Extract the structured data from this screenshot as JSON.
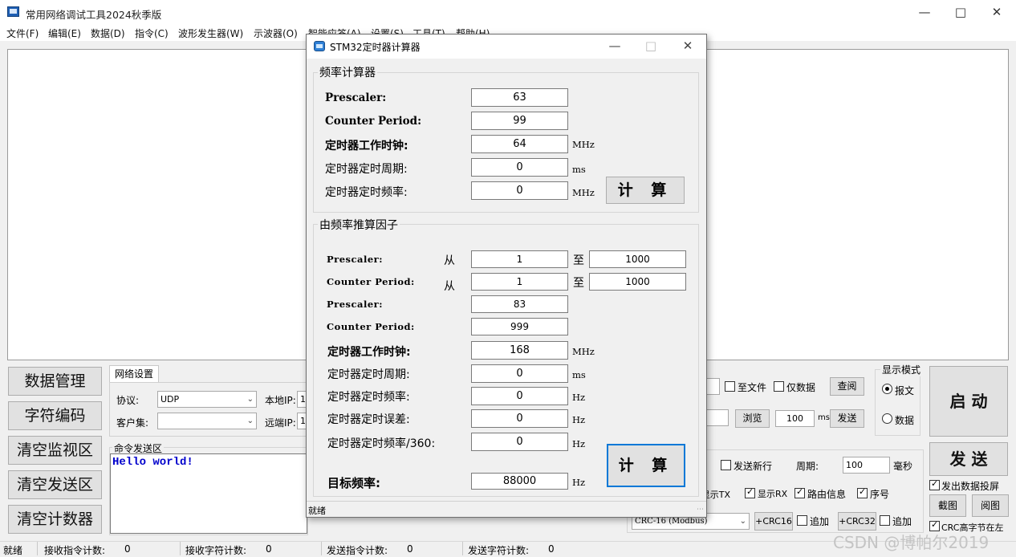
{
  "window": {
    "title": "常用网络调试工具2024秋季版"
  },
  "menu": [
    "文件(F)",
    "编辑(E)",
    "数据(D)",
    "指令(C)",
    "波形发生器(W)",
    "示波器(O)",
    "智能应答(A)",
    "设置(S)",
    "工具(T)",
    "帮助(H)"
  ],
  "left_buttons": [
    "数据管理",
    "字符编码",
    "清空监视区",
    "清空发送区",
    "清空计数器"
  ],
  "net": {
    "tab": "网络设置",
    "protocol_label": "协议:",
    "protocol_value": "UDP",
    "local_ip_label": "本地IP:",
    "local_ip_value": "1",
    "client_label": "客户集:",
    "client_value": "",
    "remote_ip_label": "远端IP:",
    "remote_ip_value": "1"
  },
  "command": {
    "title": "命令发送区",
    "text": "Hello world!"
  },
  "receive_opts": {
    "to_file": "至文件",
    "data_only": "仅数据",
    "view": "查阅",
    "browse": "浏览",
    "interval": "100",
    "ms": "ms",
    "send": "发送"
  },
  "send_opts": {
    "newline": "发送新行",
    "period_label": "周期:",
    "period_value": "100",
    "period_unit": "毫秒",
    "show_tx": "显示TX",
    "show_rx": "显示RX",
    "route_info": "路由信息",
    "seq": "序号",
    "crc_select": "CRC-16 (Modbus)",
    "crc16": "+CRC16",
    "append1": "追加",
    "crc32": "+CRC32",
    "append2": "追加"
  },
  "display_mode": {
    "title": "显示模式",
    "option1": "报文",
    "option2": "数据"
  },
  "right": {
    "start": "启 动",
    "send": "发 送",
    "sendout_screen": "发出数据投屏",
    "screenshot": "截图",
    "view_image": "阅图",
    "crc_high": "CRC高字节在左"
  },
  "status": {
    "ready": "就绪",
    "rx_cmd_label": "接收指令计数:",
    "rx_cmd": "0",
    "rx_char_label": "接收字符计数:",
    "rx_char": "0",
    "tx_cmd_label": "发送指令计数:",
    "tx_cmd": "0",
    "tx_char_label": "发送字符计数:",
    "tx_char": "0"
  },
  "watermark": "CSDN @博帕尔2019",
  "dialog": {
    "title": "STM32定时器计算器",
    "freq_calc": {
      "title": "频率计算器",
      "prescaler_label": "Prescaler:",
      "prescaler": "63",
      "period_label": "Counter Period:",
      "period": "99",
      "clock_label": "定时器工作时钟:",
      "clock": "64",
      "clock_unit": "MHz",
      "timer_period_label": "定时器定时周期:",
      "timer_period": "0",
      "timer_period_unit": "ms",
      "timer_freq_label": "定时器定时频率:",
      "timer_freq": "0",
      "timer_freq_unit": "MHz",
      "calc": "计 算"
    },
    "factor_calc": {
      "title": "由频率推算因子",
      "prescaler_range_label": "Prescaler:",
      "from1": "从",
      "pre_from": "1",
      "to1": "至",
      "pre_to": "1000",
      "period_range_label": "Counter Period:",
      "from2": "从",
      "per_from": "1",
      "to2": "至",
      "per_to": "1000",
      "prescaler_label": "Prescaler:",
      "prescaler": "83",
      "period_label": "Counter Period:",
      "period": "999",
      "clock_label": "定时器工作时钟:",
      "clock": "168",
      "clock_unit": "MHz",
      "timer_period_label": "定时器定时周期:",
      "timer_period": "0",
      "timer_period_unit": "ms",
      "timer_freq_label": "定时器定时频率:",
      "timer_freq": "0",
      "timer_freq_unit": "Hz",
      "timer_err_label": "定时器定时误差:",
      "timer_err": "0",
      "timer_err_unit": "Hz",
      "timer_freq360_label": "定时器定时频率/360:",
      "timer_freq360": "0",
      "timer_freq360_unit": "Hz",
      "target_label": "目标频率:",
      "target": "88000",
      "target_unit": "Hz",
      "calc": "计 算"
    },
    "status": "就绪"
  }
}
